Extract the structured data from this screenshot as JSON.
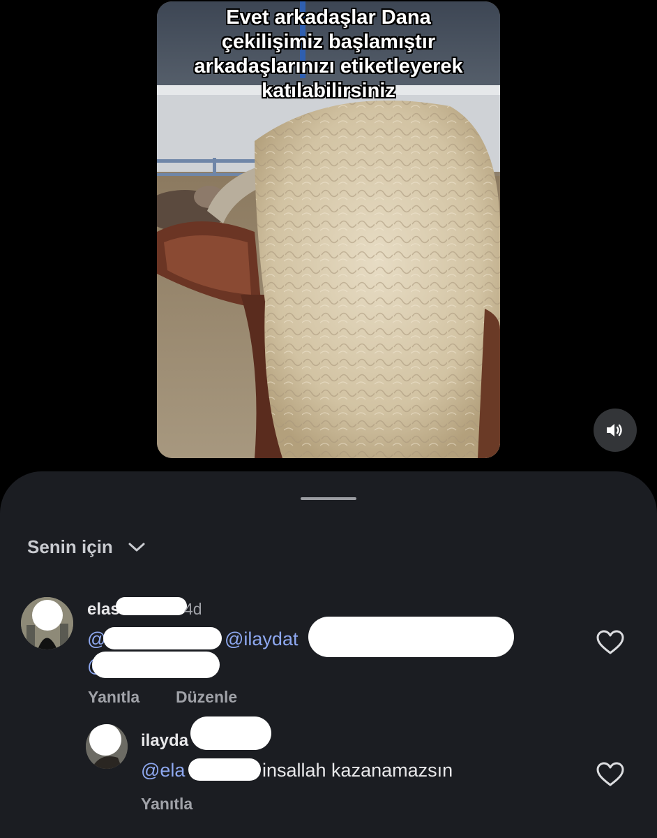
{
  "video": {
    "caption": "Evet arkadaşlar Dana\nçekilişimiz başlamıştır\narkadaşlarınızı etiketleyerek\nkatılabilirsiniz",
    "sound_icon": "speaker-volume-icon"
  },
  "comments_sheet": {
    "sort_label": "Senin için",
    "sort_icon": "chevron-down-icon",
    "comments": [
      {
        "username": "elas",
        "username_suffix": "4d",
        "mentions": [
          "@",
          "@ilaydat",
          "@"
        ],
        "actions": [
          "Yanıtla",
          "Düzenle"
        ],
        "like_icon": "heart-outline-icon"
      },
      {
        "username": "ilayda",
        "mention": "@ela",
        "text": "insallah kazanamazsın",
        "actions": [
          "Yanıtla"
        ],
        "like_icon": "heart-outline-icon"
      }
    ]
  },
  "colors": {
    "background": "#000000",
    "sheet": "#1b1d22",
    "mention": "#8ea8f0",
    "muted_text": "#a0a2a8"
  }
}
